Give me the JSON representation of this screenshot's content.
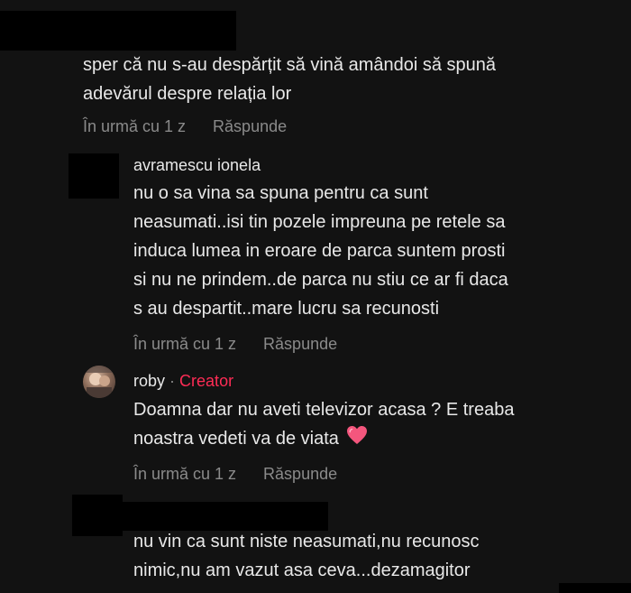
{
  "comments": [
    {
      "text": "sper că nu s-au despărțit să vină amândoi să spună\nadevărul despre relația lor",
      "time": "În urmă cu 1 z",
      "reply": "Răspunde"
    },
    {
      "username": "avramescu ionela",
      "text": "nu o sa vina sa spuna pentru ca sunt\nneasumati..isi tin pozele impreuna pe retele sa\ninduca lumea in eroare de parca suntem prosti\nsi nu ne prindem..de parca nu stiu ce ar fi daca\ns au despartit..mare lucru sa recunosti",
      "time": "În urmă cu 1 z",
      "reply": "Răspunde"
    },
    {
      "username": "roby",
      "separator": "·",
      "badge": "Creator",
      "text": "Doamna dar nu aveti televizor acasa ? E treaba\nnoastra vedeti va de viata",
      "emoji": "heart-emoji",
      "time": "În urmă cu 1 z",
      "reply": "Răspunde"
    },
    {
      "text": "nu vin ca sunt niste neasumati,nu recunosc\nnimic,nu am vazut asa ceva...dezamagitor"
    }
  ],
  "colors": {
    "background": "#121212",
    "text": "#e8e8e8",
    "meta": "#8a8a8a",
    "creator": "#fe2c55",
    "heart": "#f4567d"
  }
}
